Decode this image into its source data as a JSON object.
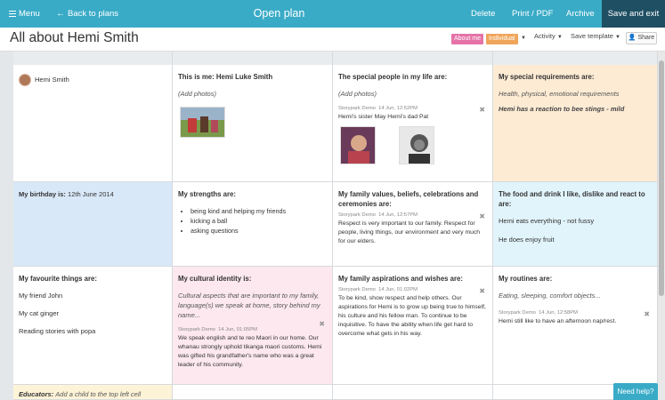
{
  "topbar": {
    "menu": "Menu",
    "back": "Back to plans",
    "title": "Open plan",
    "delete": "Delete",
    "print": "Print / PDF",
    "archive": "Archive",
    "save_exit": "Save and exit"
  },
  "header": {
    "title": "All about Hemi Smith",
    "tag_about": "About me",
    "tag_individual": "Individual",
    "activity": "Activity",
    "save_template": "Save template",
    "share": "Share"
  },
  "cells": {
    "child_name": "Hemi Smith",
    "this_is_me": {
      "heading": "This is me: Hemi Luke Smith",
      "hint": "(Add photos)"
    },
    "special_people": {
      "heading": "The special people in my life are:",
      "hint": "(Add photos)",
      "meta_author": "Storypark Demo",
      "meta_time": "14 Jun, 12:52PM",
      "text": "Hemi's sister May Hemi's dad Pat"
    },
    "special_req": {
      "heading": "My special requirements are:",
      "hint": "Health, physical, emotional requirements",
      "text": "Hemi has a reaction to bee stings - mild"
    },
    "birthday": {
      "label": "My birthday is:",
      "value": "12th June 2014"
    },
    "strengths": {
      "heading": "My strengths are:",
      "items": [
        "being kind and helping my friends",
        "kicking a ball",
        "asking questions"
      ]
    },
    "family_values": {
      "heading": "My family values, beliefs, celebrations and ceremonies are:",
      "meta_author": "Storypark Demo",
      "meta_time": "14 Jun, 12:57PM",
      "text": "Respect is very important to our family. Respect for people, living things, our environment and very much for our elders."
    },
    "food": {
      "heading": "The food and drink I like, dislike and react to are:",
      "line1": "Hemi eats everything - not fussy",
      "line2": "He does enjoy fruit"
    },
    "favourites": {
      "heading": "My favourite things are:",
      "items": [
        "My friend John",
        "My cat ginger",
        "Reading stories with popa"
      ]
    },
    "cultural": {
      "heading": "My cultural identity is:",
      "hint": "Cultural aspects that are important to my family, language(s) we speak at home, story behind my name...",
      "meta_author": "Storypark Demo",
      "meta_time": "14 Jun, 01:05PM",
      "text": "We speak english and te reo Maori in our home. Our whanau strongly uphold tikanga maori customs. Hemi was gifted his grandfather's name who was a great leader of his community."
    },
    "aspirations": {
      "heading": "My family aspirations and wishes are:",
      "meta_author": "Storypark Demo",
      "meta_time": "14 Jun, 01:02PM",
      "text": "To be kind, show respect and help others. Our aspirations for Hemi is to grow up being true to himself, his culture and his fellow man. To continue to be inquisitive. To have the ability when life get hard to overcome what gets in his way."
    },
    "routines": {
      "heading": "My routines are:",
      "hint": "Eating, sleeping, comfort objects...",
      "meta_author": "Storypark Demo",
      "meta_time": "14 Jun, 12:58PM",
      "text": "Hemi still like to have an afternoon nap/rest."
    },
    "educators": {
      "label": "Educators:",
      "hint": "Add a child to the top left cell"
    }
  },
  "help": "Need help?"
}
